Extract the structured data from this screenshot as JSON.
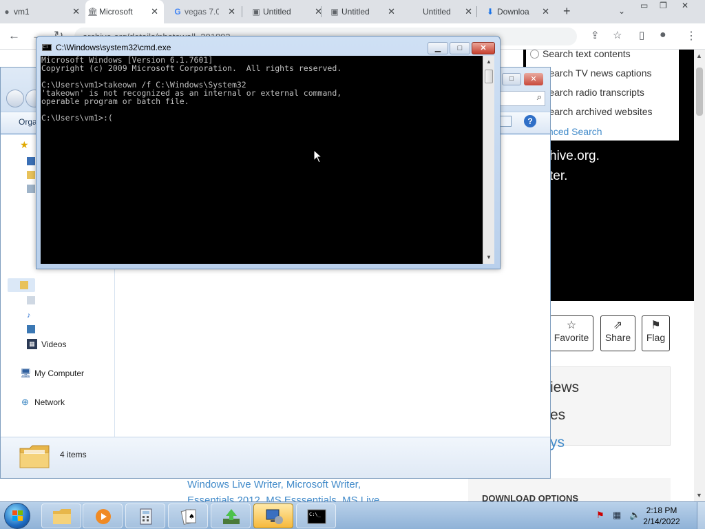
{
  "browser": {
    "tabs": [
      {
        "title": "vm1",
        "icon": "github-icon"
      },
      {
        "title": "Microsoft",
        "icon": "archive-icon"
      },
      {
        "title": "vegas 7.0",
        "icon": "google-icon"
      },
      {
        "title": "Untitled",
        "icon": "folder-icon"
      },
      {
        "title": "Untitled",
        "icon": "folder-icon"
      },
      {
        "title": "Untitled",
        "icon": ""
      },
      {
        "title": "Downloa",
        "icon": "download-icon"
      }
    ],
    "new_tab_label": "+",
    "address": "archive.org/details/photowall_201803"
  },
  "webpage": {
    "search_options": [
      "Search text contents",
      "Search TV news captions",
      "Search radio transcripts",
      "Search archived websites"
    ],
    "advanced_search": "Advanced Search",
    "hero_line1": "hive.org.",
    "hero_line2": "ter.",
    "actions": [
      {
        "label": "Favorite",
        "icon": "star-icon"
      },
      {
        "label": "Share",
        "icon": "share-icon"
      },
      {
        "label": "Flag",
        "icon": "flag-icon"
      }
    ],
    "stats": [
      "iews",
      "es",
      "ys"
    ],
    "download_options": "DOWNLOAD OPTIONS",
    "subjects_line1": "Windows Live Writer, Microsoft Writer,",
    "subjects_line2": "Essentials 2012, MS Esssentials, MS Live"
  },
  "explorer": {
    "organize": "Orga",
    "sidebar": [
      {
        "label": "Videos",
        "icon": "video-library-icon"
      },
      {
        "label": "My Computer",
        "icon": "computer-icon"
      },
      {
        "label": "Network",
        "icon": "network-icon"
      }
    ],
    "status": "4 items"
  },
  "cmd": {
    "title": "C:\\Windows\\system32\\cmd.exe",
    "lines": [
      "Microsoft Windows [Version 6.1.7601]",
      "Copyright (c) 2009 Microsoft Corporation.  All rights reserved.",
      "",
      "C:\\Users\\vm1>takeown /f C:\\Windows\\System32",
      "'takeown' is not recognized as an internal or external command,",
      "operable program or batch file.",
      "",
      "C:\\Users\\vm1>:("
    ]
  },
  "taskbar": {
    "time": "2:18 PM",
    "date": "2/14/2022"
  },
  "colors": {
    "link": "#428bca",
    "console_bg": "#000000",
    "console_text": "#c0c0c0"
  }
}
